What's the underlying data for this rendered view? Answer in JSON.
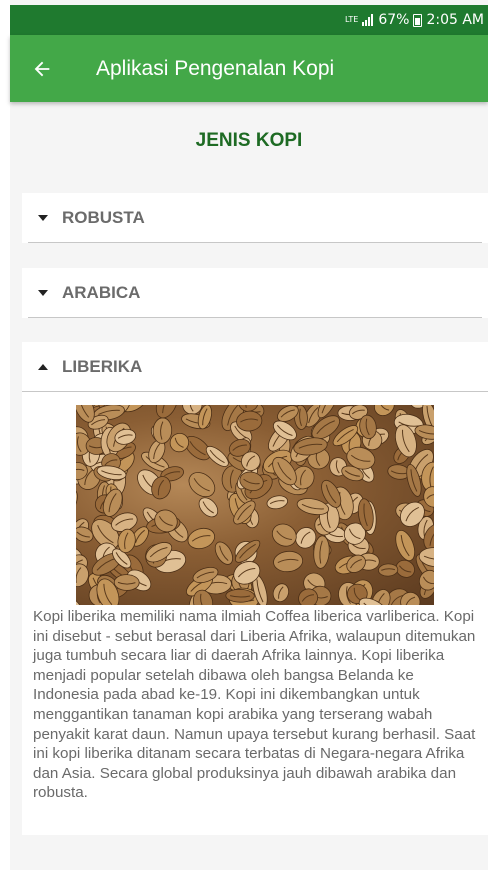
{
  "status_bar": {
    "network": "LTE",
    "battery_percent": "67%",
    "time": "2:05 AM",
    "icons": [
      "lte-icon",
      "signal-icon",
      "battery-icon"
    ]
  },
  "app_bar": {
    "back_icon": "arrow-left-icon",
    "title": "Aplikasi Pengenalan Kopi"
  },
  "section_title": "JENIS KOPI",
  "groups": [
    {
      "label": "ROBUSTA",
      "expanded": false
    },
    {
      "label": "ARABICA",
      "expanded": false
    },
    {
      "label": "LIBERIKA",
      "expanded": true
    }
  ],
  "liberika": {
    "image_icon": "coffee-beans-photo",
    "description": "Kopi liberika memiliki nama ilmiah Coffea liberica varliberica. Kopi ini disebut - sebut berasal dari Liberia Afrika, walaupun ditemukan juga tumbuh secara liar di daerah Afrika lainnya. Kopi liberika menjadi popular setelah dibawa oleh bangsa Belanda ke Indonesia pada abad ke-19. Kopi ini dikembangkan untuk menggantikan tanaman kopi arabika yang terserang wabah penyakit karat daun. Namun upaya tersebut kurang berhasil. Saat ini kopi liberika ditanam secara terbatas di Negara-negara Afrika dan Asia. Secara global produksinya jauh dibawah arabika dan robusta."
  },
  "colors": {
    "status_bar": "#1f7a2f",
    "app_bar": "#43a848",
    "section_title": "#1e6b24",
    "group_label": "#6b6b6b",
    "description": "#6a6a6a"
  }
}
